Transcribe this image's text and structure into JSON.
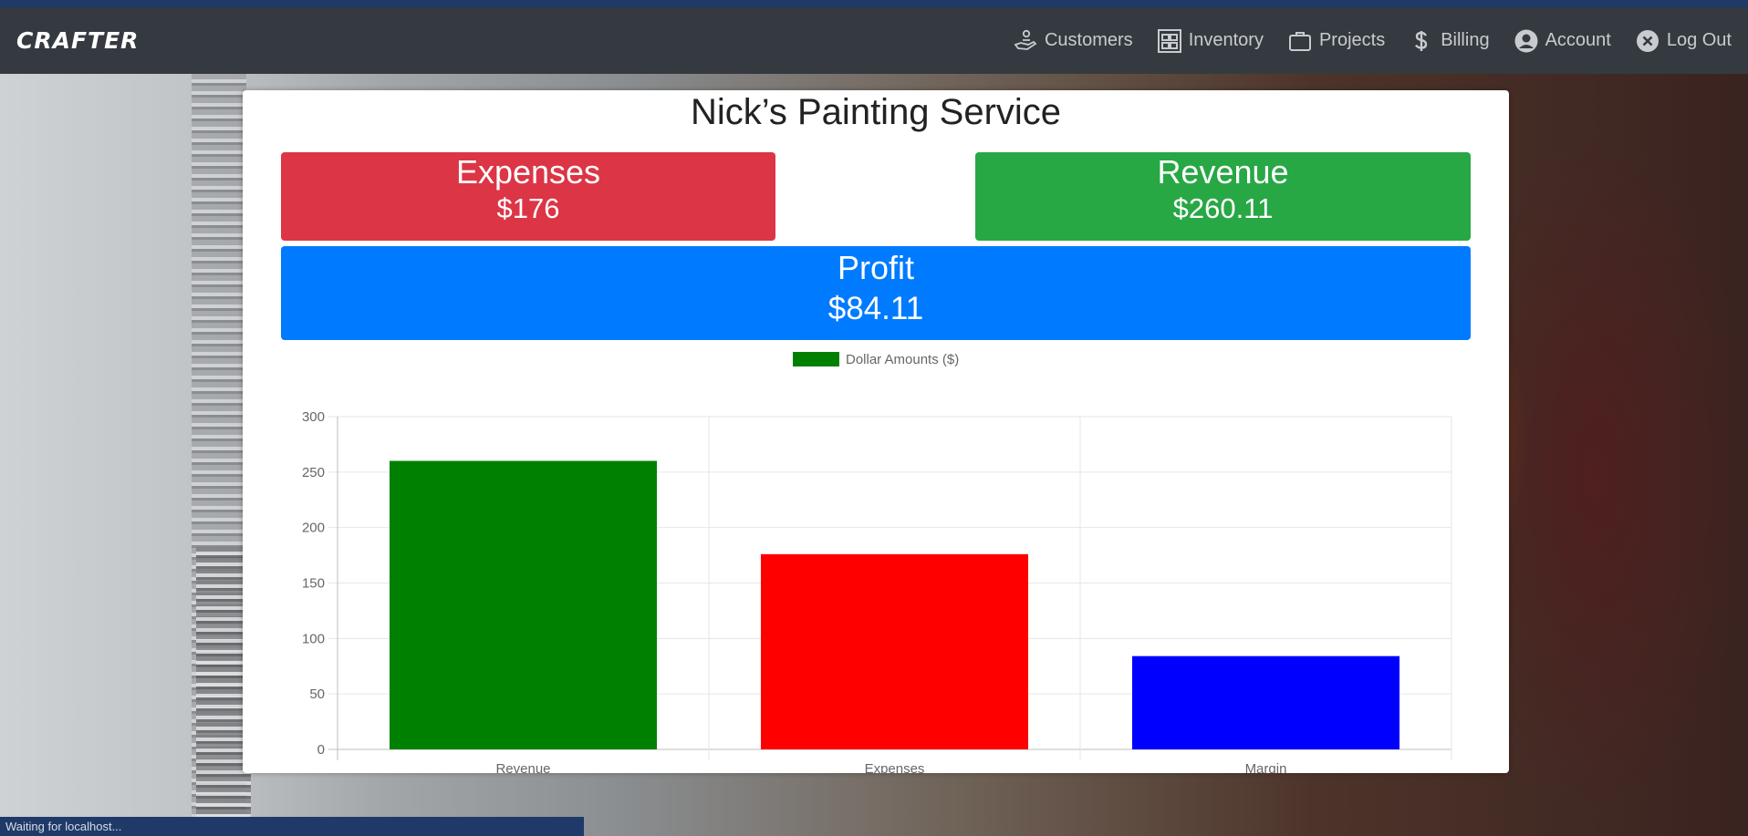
{
  "brand": "CRAFTER",
  "nav": {
    "customers": "Customers",
    "inventory": "Inventory",
    "projects": "Projects",
    "billing": "Billing",
    "account": "Account",
    "logout": "Log Out"
  },
  "business": {
    "title": "Nick’s Painting Service"
  },
  "stats": {
    "expenses": {
      "label": "Expenses",
      "value": "$176",
      "color": "#dc3545"
    },
    "revenue": {
      "label": "Revenue",
      "value": "$260.11",
      "color": "#28a745"
    },
    "profit": {
      "label": "Profit",
      "value": "$84.11",
      "color": "#007bff"
    }
  },
  "chart_data": {
    "type": "bar",
    "categories": [
      "Revenue",
      "Expenses",
      "Margin"
    ],
    "series": [
      {
        "name": "Dollar Amounts ($)",
        "values": [
          260.11,
          176,
          84.11
        ],
        "colors": [
          "#008000",
          "#ff0000",
          "#0000ff"
        ]
      }
    ],
    "ylim": [
      0,
      300
    ],
    "yticks": [
      0,
      50,
      100,
      150,
      200,
      250,
      300
    ],
    "legend_color": "#008000",
    "legend_position": "top",
    "grid": true
  },
  "status": "Waiting for localhost..."
}
